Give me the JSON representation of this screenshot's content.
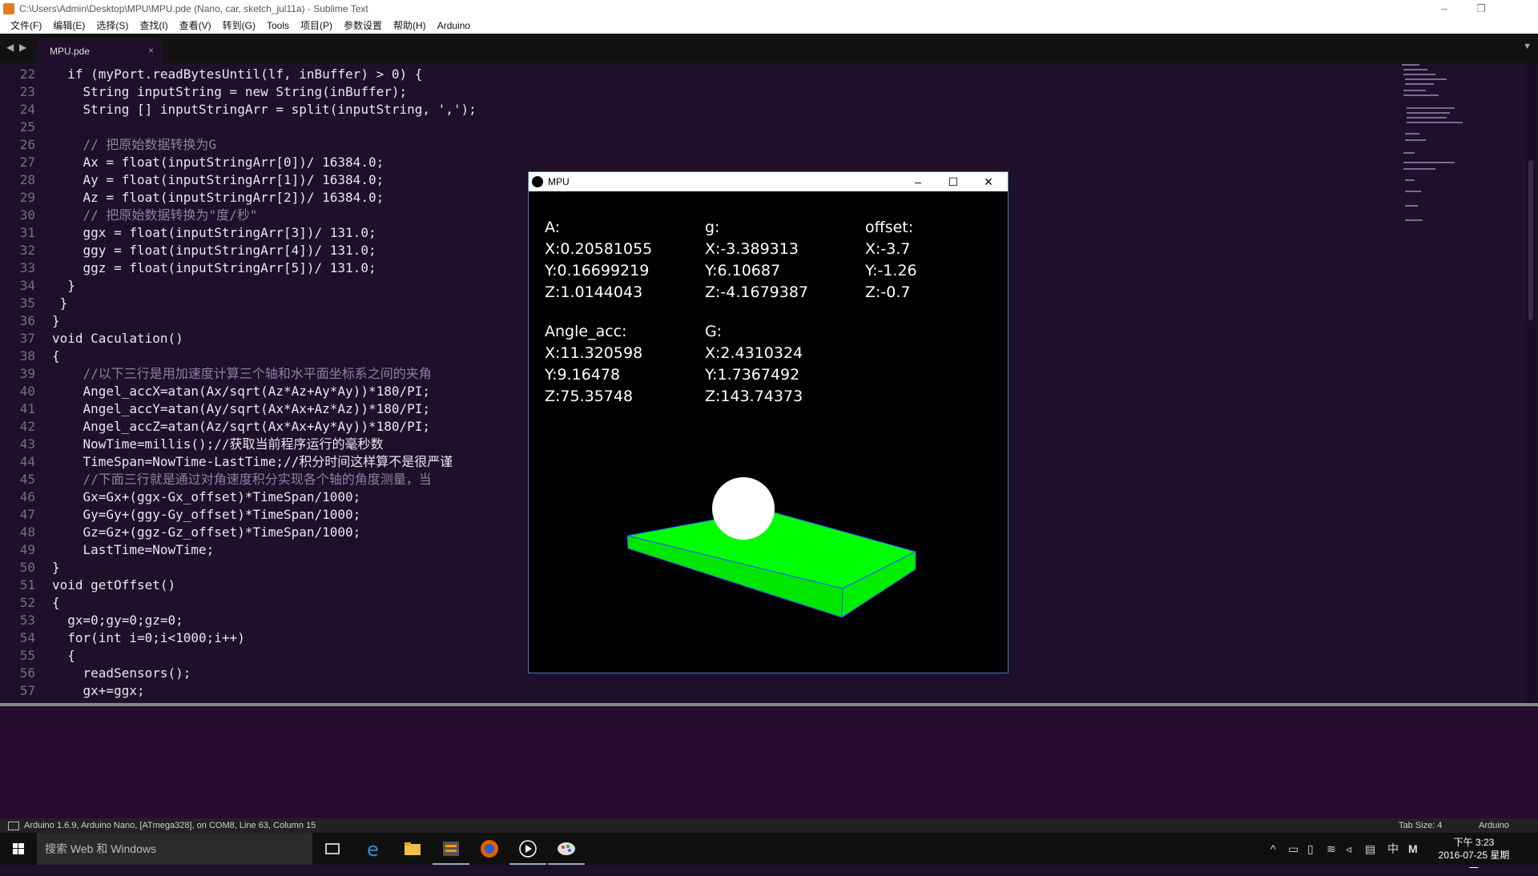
{
  "window": {
    "title": "C:\\Users\\Admin\\Desktop\\MPU\\MPU.pde (Nano, car, sketch_jul11a) - Sublime Text",
    "controls": [
      "–",
      "❐",
      ""
    ]
  },
  "menu": [
    "文件(F)",
    "编辑(E)",
    "选择(S)",
    "查找(I)",
    "查看(V)",
    "转到(G)",
    "Tools",
    "项目(P)",
    "参数设置",
    "帮助(H)",
    "Arduino"
  ],
  "tab": {
    "label": "MPU.pde",
    "close": "×",
    "dropdown": "▼",
    "nav_left": "◀",
    "nav_right": "▶"
  },
  "editor": {
    "lines": [
      {
        "n": "22",
        "t": "  if (myPort.readBytesUntil(lf, inBuffer) > 0) {"
      },
      {
        "n": "23",
        "t": "    String inputString = new String(inBuffer);"
      },
      {
        "n": "24",
        "t": "    String [] inputStringArr = split(inputString, ',');"
      },
      {
        "n": "25",
        "t": ""
      },
      {
        "n": "26",
        "t": "    // 把原始数据转换为G"
      },
      {
        "n": "27",
        "t": "    Ax = float(inputStringArr[0])/ 16384.0;"
      },
      {
        "n": "28",
        "t": "    Ay = float(inputStringArr[1])/ 16384.0;"
      },
      {
        "n": "29",
        "t": "    Az = float(inputStringArr[2])/ 16384.0;"
      },
      {
        "n": "30",
        "t": "    // 把原始数据转换为\"度/秒\""
      },
      {
        "n": "31",
        "t": "    ggx = float(inputStringArr[3])/ 131.0;"
      },
      {
        "n": "32",
        "t": "    ggy = float(inputStringArr[4])/ 131.0;"
      },
      {
        "n": "33",
        "t": "    ggz = float(inputStringArr[5])/ 131.0;"
      },
      {
        "n": "34",
        "t": "  }"
      },
      {
        "n": "35",
        "t": " }"
      },
      {
        "n": "36",
        "t": "}"
      },
      {
        "n": "37",
        "t": "void Caculation()"
      },
      {
        "n": "38",
        "t": "{"
      },
      {
        "n": "39",
        "t": "    //以下三行是用加速度计算三个轴和水平面坐标系之间的夹角"
      },
      {
        "n": "40",
        "t": "    Angel_accX=atan(Ax/sqrt(Az*Az+Ay*Ay))*180/PI;"
      },
      {
        "n": "41",
        "t": "    Angel_accY=atan(Ay/sqrt(Ax*Ax+Az*Az))*180/PI;"
      },
      {
        "n": "42",
        "t": "    Angel_accZ=atan(Az/sqrt(Ax*Ax+Ay*Ay))*180/PI;"
      },
      {
        "n": "43",
        "t": "    NowTime=millis();//获取当前程序运行的毫秒数"
      },
      {
        "n": "44",
        "t": "    TimeSpan=NowTime-LastTime;//积分时间这样算不是很严谨"
      },
      {
        "n": "45",
        "t": "    //下面三行就是通过对角速度积分实现各个轴的角度测量，当"
      },
      {
        "n": "46",
        "t": "    Gx=Gx+(ggx-Gx_offset)*TimeSpan/1000;"
      },
      {
        "n": "47",
        "t": "    Gy=Gy+(ggy-Gy_offset)*TimeSpan/1000;"
      },
      {
        "n": "48",
        "t": "    Gz=Gz+(ggz-Gz_offset)*TimeSpan/1000;"
      },
      {
        "n": "49",
        "t": "    LastTime=NowTime;"
      },
      {
        "n": "50",
        "t": "}"
      },
      {
        "n": "51",
        "t": "void getOffset()"
      },
      {
        "n": "52",
        "t": "{"
      },
      {
        "n": "53",
        "t": "  gx=0;gy=0;gz=0;"
      },
      {
        "n": "54",
        "t": "  for(int i=0;i<1000;i++)"
      },
      {
        "n": "55",
        "t": "  {"
      },
      {
        "n": "56",
        "t": "    readSensors();"
      },
      {
        "n": "57",
        "t": "    gx+=ggx;"
      }
    ]
  },
  "mpu": {
    "title": "MPU",
    "controls": [
      "–",
      "☐",
      "✕"
    ],
    "A": {
      "label": "A:",
      "x": "X:0.20581055",
      "y": "Y:0.16699219",
      "z": "Z:1.0144043"
    },
    "g": {
      "label": "g:",
      "x": "X:-3.389313",
      "y": "Y:6.10687",
      "z": "Z:-4.1679387"
    },
    "offset": {
      "label": "offset:",
      "x": "X:-3.7",
      "y": "Y:-1.26",
      "z": "Z:-0.7"
    },
    "angle_acc": {
      "label": "Angle_acc:",
      "x": "X:11.320598",
      "y": "Y:9.16478",
      "z": "Z:75.35748"
    },
    "G": {
      "label": "G:",
      "x": "X:2.4310324",
      "y": "Y:1.7367492",
      "z": "Z:143.74373"
    },
    "colors": {
      "board": "#00ff00",
      "edge": "#2255ff",
      "ball": "#ffffff"
    }
  },
  "status": {
    "message": "Arduino 1.6.9, Arduino Nano, [ATmega328], on COM8, Line 63, Column 15",
    "tab_size": "Tab Size: 4",
    "syntax": "Arduino"
  },
  "taskbar": {
    "search_placeholder": "搜索 Web 和 Windows",
    "tray_icons": [
      "chevron-up-icon",
      "network-icon",
      "battery-icon",
      "wifi-icon",
      "volume-mute-icon",
      "notification-icon"
    ],
    "ime": "中",
    "ime2": "M",
    "time": "下午 3:23",
    "date": "2016-07-25 星期一"
  }
}
